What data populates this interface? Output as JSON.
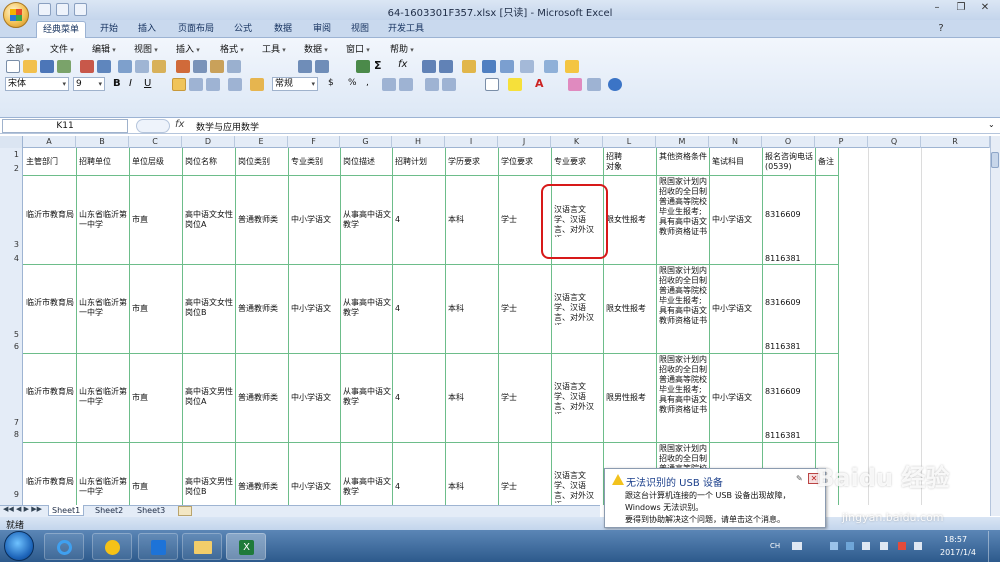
{
  "window": {
    "title": "64-1603301F357.xlsx  [只读] - Microsoft Excel"
  },
  "ribbon": {
    "tabs": [
      "经典菜单",
      "开始",
      "插入",
      "页面布局",
      "公式",
      "数据",
      "审阅",
      "视图",
      "开发工具"
    ],
    "active_tab": "经典菜单",
    "menus": [
      "全部",
      "文件",
      "编辑",
      "视图",
      "插入",
      "格式",
      "工具",
      "数据",
      "窗口",
      "帮助"
    ],
    "font_name": "宋体",
    "font_size": "9",
    "number_format": "常规"
  },
  "formula_bar": {
    "cell_ref": "K11",
    "fx": "fx",
    "content": "数学与应用数学"
  },
  "grid": {
    "columns": [
      "A",
      "B",
      "C",
      "D",
      "E",
      "F",
      "G",
      "H",
      "I",
      "J",
      "K",
      "L",
      "M",
      "N",
      "O",
      "P",
      "Q",
      "R"
    ],
    "row_numbers": [
      "1",
      "2",
      "3",
      "4",
      "5",
      "6",
      "7",
      "8",
      "9"
    ],
    "header": [
      "主管部门",
      "招聘单位",
      "单位层级",
      "岗位名称",
      "岗位类别",
      "专业类别",
      "岗位描述",
      "招聘计划",
      "学历要求",
      "学位要求",
      "专业要求",
      "招聘\n对象",
      "其他资格条件",
      "笔试科目",
      "报名咨询电话(0539)",
      "备注"
    ],
    "records": [
      {
        "a": "临沂市教育局",
        "b": "山东省临沂第一中学",
        "c": "市直",
        "d": "高中语文女性岗位A",
        "e": "普通教师类",
        "f": "中小学语文",
        "g": "从事高中语文教学",
        "h": "4",
        "i": "本科",
        "j": "学士",
        "k": "汉语言文学、汉语言、对外汉语",
        "l": "限女性报考",
        "m": "限国家计划内招收的全日制普通高等院校毕业生报考;具有高中语文教师资格证书",
        "n": "中小学语文",
        "o1": "8316609",
        "o2": "8116381"
      },
      {
        "a": "临沂市教育局",
        "b": "山东省临沂第一中学",
        "c": "市直",
        "d": "高中语文女性岗位B",
        "e": "普通教师类",
        "f": "中小学语文",
        "g": "从事高中语文教学",
        "h": "4",
        "i": "本科",
        "j": "学士",
        "k": "汉语言文学、汉语言、对外汉语",
        "l": "限女性报考",
        "m": "限国家计划内招收的全日制普通高等院校毕业生报考;具有高中语文教师资格证书",
        "n": "中小学语文",
        "o1": "8316609",
        "o2": "8116381"
      },
      {
        "a": "临沂市教育局",
        "b": "山东省临沂第一中学",
        "c": "市直",
        "d": "高中语文男性岗位A",
        "e": "普通教师类",
        "f": "中小学语文",
        "g": "从事高中语文教学",
        "h": "4",
        "i": "本科",
        "j": "学士",
        "k": "汉语言文学、汉语言、对外汉语",
        "l": "限男性报考",
        "m": "限国家计划内招收的全日制普通高等院校毕业生报考;具有高中语文教师资格证书",
        "n": "中小学语文",
        "o1": "8316609",
        "o2": "8116381"
      },
      {
        "a": "临沂市教育局",
        "b": "山东省临沂第一中学",
        "c": "市直",
        "d": "高中语文男性岗位B",
        "e": "普通教师类",
        "f": "中小学语文",
        "g": "从事高中语文教学",
        "h": "4",
        "i": "本科",
        "j": "学士",
        "k": "汉语言文学、汉语言、对外汉语",
        "l": "",
        "m": "限国家计划内招收的全日制普通高等院校毕业生报考",
        "n": "",
        "o1": "",
        "o2": ""
      }
    ]
  },
  "sheets": [
    "Sheet1",
    "Sheet2",
    "Sheet3"
  ],
  "status": "就绪",
  "notification": {
    "title": "无法识别的 USB 设备",
    "lines": [
      "跟这台计算机连接的一个 USB 设备出现故障，",
      "Windows 无法识别。",
      "要得到协助解决这个问题，请单击这个消息。"
    ]
  },
  "taskbar": {
    "lang": "CH",
    "time": "18:57",
    "date": "2017/1/4"
  },
  "watermark": {
    "text": "Baidu 经验",
    "url": "jingyan.baidu.com"
  },
  "colors": {
    "highlight": "#d71919",
    "grid_line": "#6dbd8a",
    "title_text": "#1b3f8b"
  }
}
